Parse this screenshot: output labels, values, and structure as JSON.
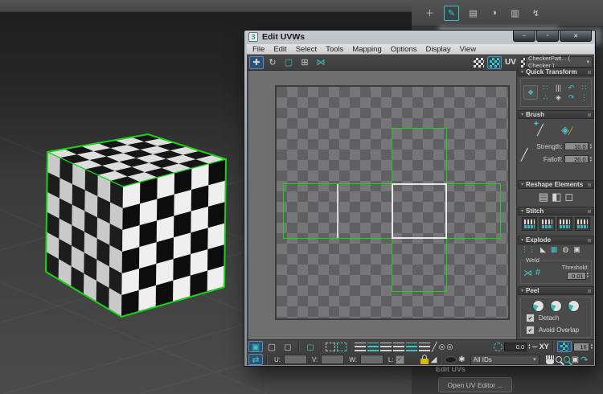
{
  "colors": {
    "selection_green": "#17d417",
    "accent_teal": "#3ec3c3",
    "active_button_blue": "#2c5172",
    "viewport_border_yellow": "#97822e"
  },
  "main_toolbar": {
    "icons": [
      {
        "name": "add",
        "glyph": "＋"
      },
      {
        "name": "edit-poly",
        "glyph": "✎"
      },
      {
        "name": "scene-tools",
        "glyph": "▤"
      },
      {
        "name": "material",
        "glyph": "◑"
      },
      {
        "name": "display",
        "glyph": "▥"
      },
      {
        "name": "utilities",
        "glyph": "↯"
      }
    ]
  },
  "uvw_window": {
    "title": "Edit UVWs",
    "icon_text": "3",
    "caption": {
      "minimize": "–",
      "maximize": "▫",
      "close": "✕"
    },
    "menu": {
      "items": [
        "File",
        "Edit",
        "Select",
        "Tools",
        "Mapping",
        "Options",
        "Display",
        "View"
      ]
    },
    "toolbar": {
      "move": "✚",
      "rotate": "↻",
      "scale": "▢",
      "freeform": "⊞",
      "mirror": "⋈",
      "uv_label": "UV",
      "dropdown_value": "CheckerPatt... ( Checker )",
      "dropdown_arrow": "▾"
    },
    "panel": {
      "header_caret": "▾",
      "quick_transform": {
        "title": "Quick Transform",
        "pivot_icon": "❖",
        "icons": [
          "∷",
          "|||",
          "↶",
          "∷",
          "∴",
          "◈",
          "↷",
          "⋮"
        ]
      },
      "brush": {
        "title": "Brush",
        "paint_icon": "╱",
        "paint_badge": "✚",
        "relax_icon": "◈",
        "relax_badge": "╱",
        "falloff_icon": "╱",
        "strength_label": "Strength:",
        "strength_value": "10.0",
        "falloff_label": "Falloff:",
        "falloff_value": "20.0",
        "spin_up": "▴",
        "spin_down": "▾"
      },
      "reshape": {
        "title": "Reshape Elements",
        "icons": [
          "▤",
          "◧",
          "◻"
        ]
      },
      "stitch": {
        "title": "Stitch"
      },
      "explode": {
        "title": "Explode",
        "icons": [
          "⋮⋮",
          "◣",
          "▦",
          "◍",
          "▣"
        ],
        "weld_label": "Weld",
        "weld_icons": [
          "⋊",
          "#"
        ],
        "threshold_label": "Threshold:",
        "threshold_value": "0.01",
        "spin_up": "▴",
        "spin_down": "▾"
      },
      "peel": {
        "title": "Peel",
        "detach_label": "Detach",
        "avoid_label": "Avoid Overlap",
        "check": "✔"
      }
    },
    "bottom": {
      "vertex_icon": "▣",
      "edge_icon": "▢",
      "face_icon": "◻",
      "element_icon": "◻",
      "brush_icon": "╱",
      "soft_icon_1": "◎",
      "soft_icon_2": "◎",
      "angle_value": "0.0",
      "curve_icon": "⌣",
      "xy_label": "XY",
      "grid_value": "16",
      "typein_icon": "⇄",
      "u_label": "U:",
      "v_label": "V:",
      "w_label": "W:",
      "l_label": "L:",
      "l_check": "✔",
      "filter_icon": "◢",
      "freeze_icon": "✱",
      "ids_value": "All IDs",
      "ids_arrow": "▾",
      "zoom_extents_icon": "▣",
      "pan_zoom_icon": "↷",
      "spin_up": "▴",
      "spin_down": "▾"
    }
  },
  "command_panel": {
    "rollout_title": "Edit UVs",
    "open_button_label": "Open UV Editor ..."
  }
}
